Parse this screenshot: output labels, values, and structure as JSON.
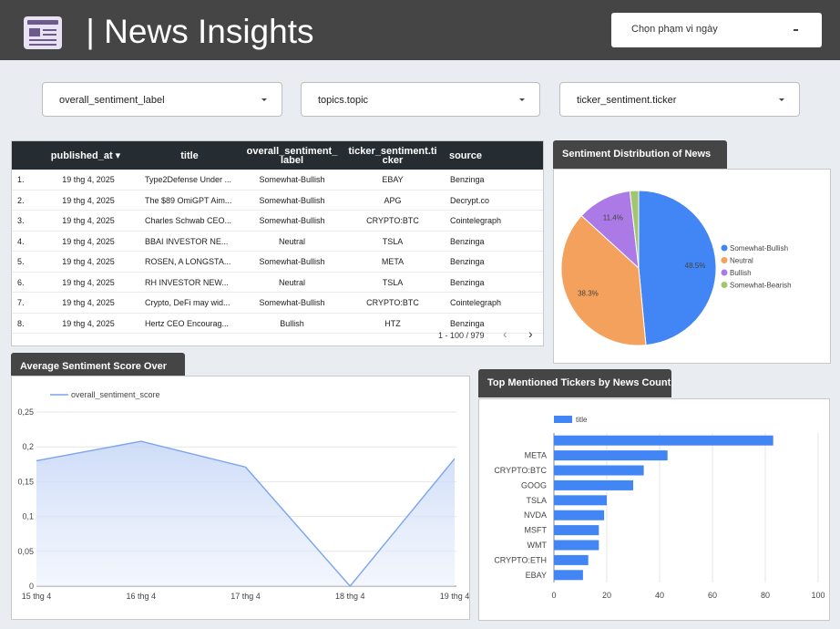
{
  "header": {
    "title": " | News Insights",
    "date_range_label": "Chọn phạm vi ngày"
  },
  "filters": [
    {
      "label": "overall_sentiment_label"
    },
    {
      "label": "topics.topic"
    },
    {
      "label": "ticker_sentiment.ticker"
    }
  ],
  "table": {
    "columns": [
      "published_at ▾",
      "title",
      "overall_sentiment_\nlabel",
      "ticker_sentiment.ti\ncker",
      "source"
    ],
    "rows": [
      {
        "n": "1.",
        "published_at": "19 thg 4, 2025",
        "title": "Type2Defense Under ...",
        "label": "Somewhat-Bullish",
        "ticker": "EBAY",
        "source": "Benzinga"
      },
      {
        "n": "2.",
        "published_at": "19 thg 4, 2025",
        "title": "The $89 OmiGPT Aim...",
        "label": "Somewhat-Bullish",
        "ticker": "APG",
        "source": "Decrypt.co"
      },
      {
        "n": "3.",
        "published_at": "19 thg 4, 2025",
        "title": "Charles Schwab CEO...",
        "label": "Somewhat-Bullish",
        "ticker": "CRYPTO:BTC",
        "source": "Cointelegraph"
      },
      {
        "n": "4.",
        "published_at": "19 thg 4, 2025",
        "title": "BBAI INVESTOR NE...",
        "label": "Neutral",
        "ticker": "TSLA",
        "source": "Benzinga"
      },
      {
        "n": "5.",
        "published_at": "19 thg 4, 2025",
        "title": "ROSEN, A LONGSTA...",
        "label": "Somewhat-Bullish",
        "ticker": "META",
        "source": "Benzinga"
      },
      {
        "n": "6.",
        "published_at": "19 thg 4, 2025",
        "title": "RH INVESTOR NEW...",
        "label": "Neutral",
        "ticker": "TSLA",
        "source": "Benzinga"
      },
      {
        "n": "7.",
        "published_at": "19 thg 4, 2025",
        "title": "Crypto, DeFi may wid...",
        "label": "Somewhat-Bullish",
        "ticker": "CRYPTO:BTC",
        "source": "Cointelegraph"
      },
      {
        "n": "8.",
        "published_at": "19 thg 4, 2025",
        "title": "Hertz CEO Encourag...",
        "label": "Bullish",
        "ticker": "HTZ",
        "source": "Benzinga"
      }
    ],
    "pagination": "1 - 100 / 979",
    "prev_icon": "‹",
    "next_icon": "›"
  },
  "chart_data": [
    {
      "type": "pie",
      "title": "Sentiment Distribution of News",
      "legend_position": "right",
      "slices": [
        {
          "label": "Somewhat-Bullish",
          "value": 48.5,
          "color": "#4285f4"
        },
        {
          "label": "Neutral",
          "value": 38.3,
          "color": "#f4a15d"
        },
        {
          "label": "Bullish",
          "value": 11.4,
          "color": "#ab7ae6"
        },
        {
          "label": "Somewhat-Bearish",
          "value": 1.8,
          "color": "#a3c56e"
        }
      ]
    },
    {
      "type": "area",
      "title": "Average Sentiment Score Over Time",
      "categories": [
        "15 thg 4",
        "16 thg 4",
        "17 thg 4",
        "18 thg 4",
        "19 thg 4"
      ],
      "series": [
        {
          "name": "overall_sentiment_score",
          "values": [
            0.18,
            0.208,
            0.171,
            0,
            0.183
          ],
          "color": "#7aa4ef"
        }
      ],
      "ylim": [
        0,
        0.25
      ],
      "yticks": [
        "0",
        "0,05",
        "0,1",
        "0,15",
        "0,2",
        "0,25"
      ],
      "legend_position": "top-left",
      "grid": true
    },
    {
      "type": "bar",
      "orientation": "horizontal",
      "title": "Top Mentioned Tickers by News Count",
      "categories": [
        "",
        "META",
        "CRYPTO:BTC",
        "GOOG",
        "TSLA",
        "NVDA",
        "MSFT",
        "WMT",
        "CRYPTO:ETH",
        "EBAY"
      ],
      "series": [
        {
          "name": "title",
          "values": [
            83,
            43,
            34,
            30,
            20,
            19,
            17,
            17,
            13,
            11
          ],
          "color": "#4285f4"
        }
      ],
      "xlim": [
        0,
        100
      ],
      "xticks": [
        "0",
        "20",
        "40",
        "60",
        "80",
        "100"
      ],
      "legend_position": "top-left",
      "grid": true
    }
  ]
}
